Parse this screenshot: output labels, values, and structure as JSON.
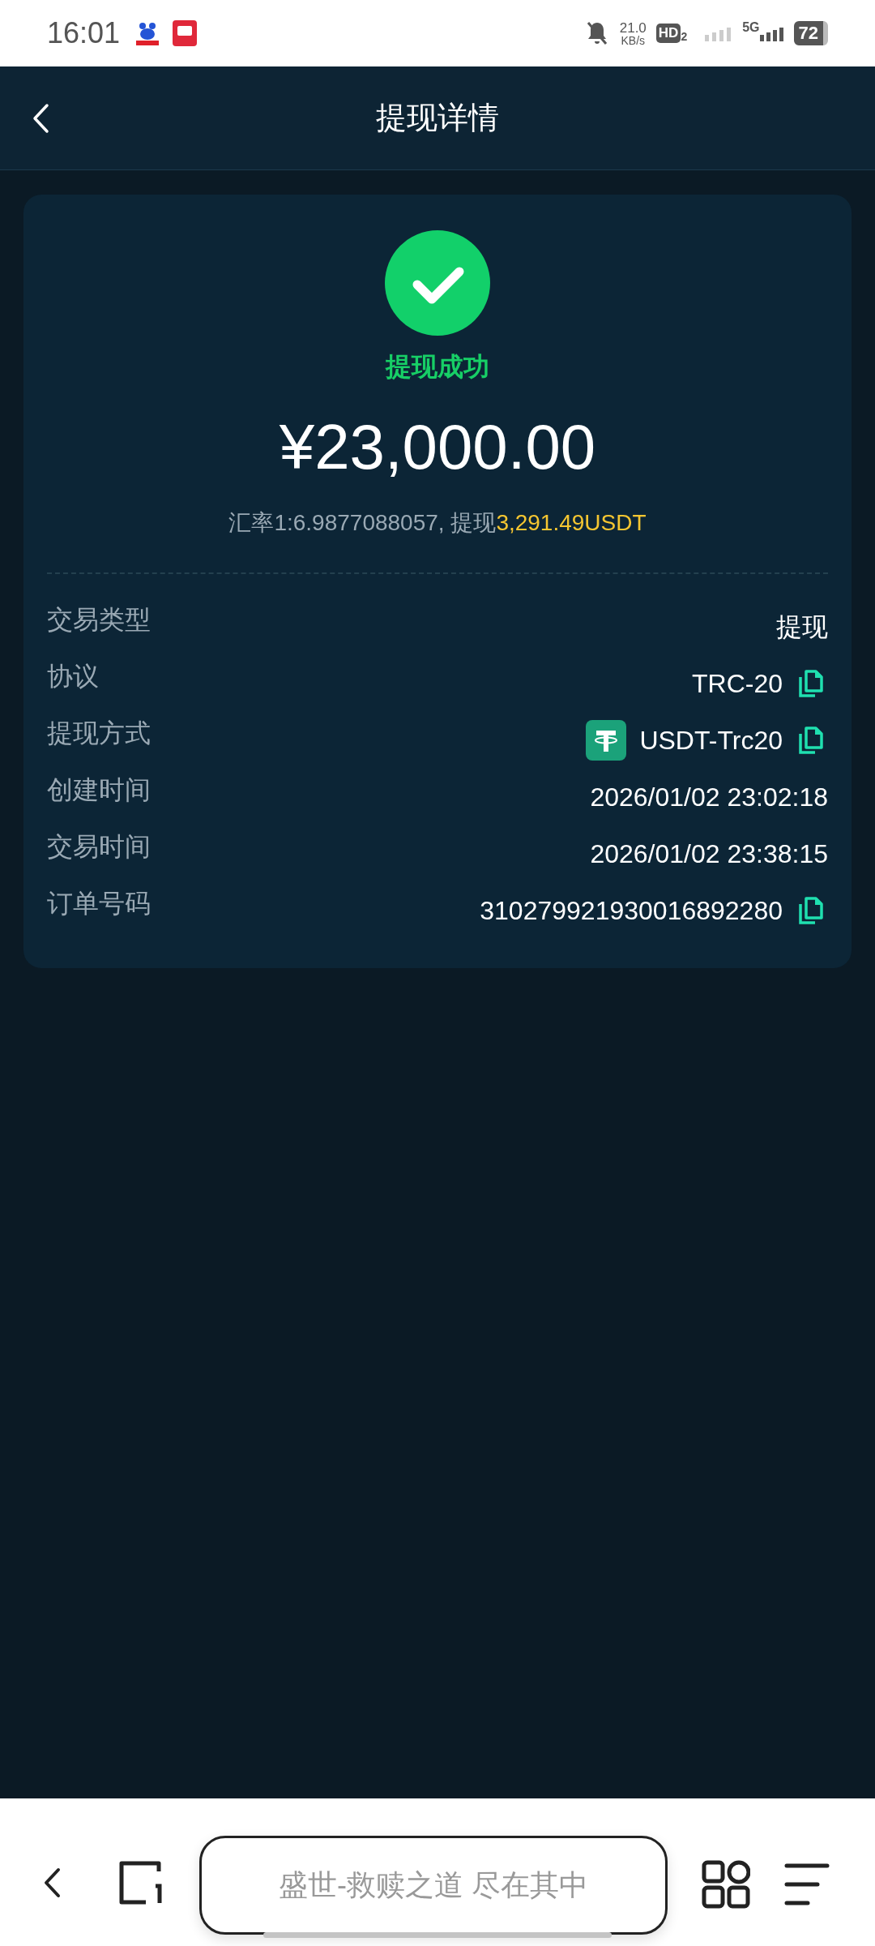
{
  "status_bar": {
    "time": "16:01",
    "net_speed": "21.0",
    "net_unit": "KB/s",
    "hd_label": "HD",
    "hd_sub": "2",
    "network": "5G",
    "battery": "72"
  },
  "header": {
    "title": "提现详情"
  },
  "result": {
    "status": "提现成功",
    "amount": "¥23,000.00",
    "rate_text": "汇率1:6.9877088057, 提现",
    "usdt_amount": "3,291.49USDT"
  },
  "details": [
    {
      "label": "交易类型",
      "value": "提现",
      "coin_icon": false,
      "copyable": false
    },
    {
      "label": "协议",
      "value": "TRC-20",
      "coin_icon": false,
      "copyable": true
    },
    {
      "label": "提现方式",
      "value": "USDT-Trc20",
      "coin_icon": true,
      "copyable": true
    },
    {
      "label": "创建时间",
      "value": "2026/01/02 23:02:18",
      "coin_icon": false,
      "copyable": false
    },
    {
      "label": "交易时间",
      "value": "2026/01/02 23:38:15",
      "coin_icon": false,
      "copyable": false
    },
    {
      "label": "订单号码",
      "value": "310279921930016892280",
      "coin_icon": false,
      "copyable": true
    }
  ],
  "browser_bar": {
    "placeholder": "盛世-救赎之道 尽在其中"
  }
}
